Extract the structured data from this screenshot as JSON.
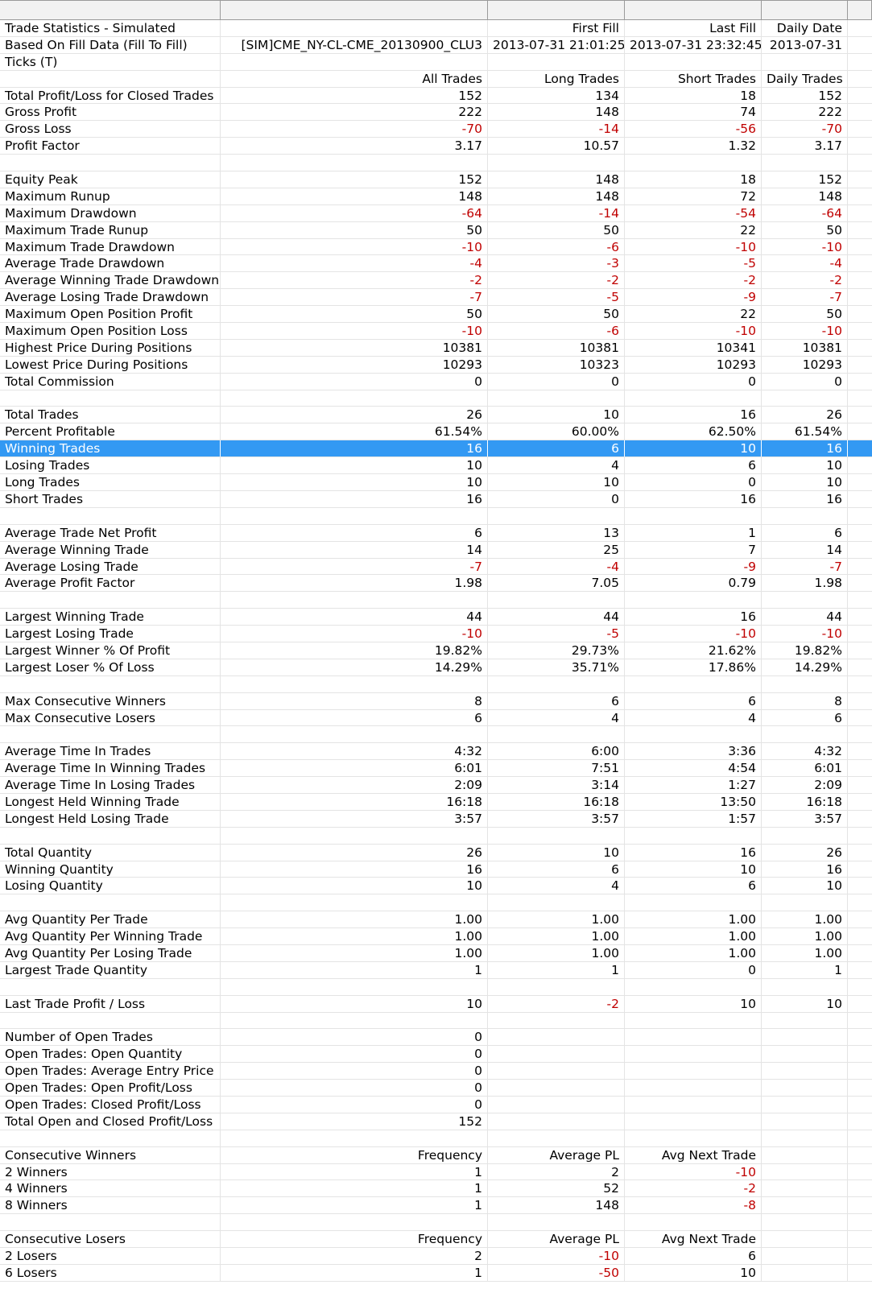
{
  "window": {
    "header_cells": [
      "",
      "",
      "",
      "",
      "",
      ""
    ]
  },
  "accent_color": "#3399f3",
  "negative_color": "#c00000",
  "selected_row": 25,
  "rows": [
    [
      "Trade Statistics - Simulated",
      "",
      "First Fill",
      "Last Fill",
      "Daily Date"
    ],
    [
      "Based On Fill Data (Fill To Fill)",
      "[SIM]CME_NY-CL-CME_20130900_CLU3",
      "2013-07-31  21:01:25",
      "2013-07-31  23:32:45",
      "2013-07-31"
    ],
    [
      "Ticks (T)",
      "",
      "",
      "",
      ""
    ],
    [
      "",
      "All Trades",
      "Long Trades",
      "Short Trades",
      "Daily Trades"
    ],
    [
      "Total Profit/Loss for Closed Trades",
      "152",
      "134",
      "18",
      "152"
    ],
    [
      "Gross Profit",
      "222",
      "148",
      "74",
      "222"
    ],
    [
      "Gross Loss",
      "-70",
      "-14",
      "-56",
      "-70"
    ],
    [
      "Profit Factor",
      "3.17",
      "10.57",
      "1.32",
      "3.17"
    ],
    [
      "",
      "",
      "",
      "",
      ""
    ],
    [
      "Equity Peak",
      "152",
      "148",
      "18",
      "152"
    ],
    [
      "Maximum Runup",
      "148",
      "148",
      "72",
      "148"
    ],
    [
      "Maximum Drawdown",
      "-64",
      "-14",
      "-54",
      "-64"
    ],
    [
      "Maximum Trade Runup",
      "50",
      "50",
      "22",
      "50"
    ],
    [
      "Maximum Trade Drawdown",
      "-10",
      "-6",
      "-10",
      "-10"
    ],
    [
      "Average Trade Drawdown",
      "-4",
      "-3",
      "-5",
      "-4"
    ],
    [
      "Average Winning Trade Drawdown",
      "-2",
      "-2",
      "-2",
      "-2"
    ],
    [
      "Average Losing Trade Drawdown",
      "-7",
      "-5",
      "-9",
      "-7"
    ],
    [
      "Maximum Open Position Profit",
      "50",
      "50",
      "22",
      "50"
    ],
    [
      "Maximum Open Position Loss",
      "-10",
      "-6",
      "-10",
      "-10"
    ],
    [
      "Highest Price During Positions",
      "10381",
      "10381",
      "10341",
      "10381"
    ],
    [
      "Lowest Price During Positions",
      "10293",
      "10323",
      "10293",
      "10293"
    ],
    [
      "Total Commission",
      "0",
      "0",
      "0",
      "0"
    ],
    [
      "",
      "",
      "",
      "",
      ""
    ],
    [
      "Total Trades",
      "26",
      "10",
      "16",
      "26"
    ],
    [
      "Percent Profitable",
      "61.54%",
      "60.00%",
      "62.50%",
      "61.54%"
    ],
    [
      "Winning Trades",
      "16",
      "6",
      "10",
      "16"
    ],
    [
      "Losing Trades",
      "10",
      "4",
      "6",
      "10"
    ],
    [
      "Long Trades",
      "10",
      "10",
      "0",
      "10"
    ],
    [
      "Short Trades",
      "16",
      "0",
      "16",
      "16"
    ],
    [
      "",
      "",
      "",
      "",
      ""
    ],
    [
      "Average Trade Net Profit",
      "6",
      "13",
      "1",
      "6"
    ],
    [
      "Average Winning Trade",
      "14",
      "25",
      "7",
      "14"
    ],
    [
      "Average Losing Trade",
      "-7",
      "-4",
      "-9",
      "-7"
    ],
    [
      "Average Profit Factor",
      "1.98",
      "7.05",
      "0.79",
      "1.98"
    ],
    [
      "",
      "",
      "",
      "",
      ""
    ],
    [
      "Largest Winning Trade",
      "44",
      "44",
      "16",
      "44"
    ],
    [
      "Largest Losing Trade",
      "-10",
      "-5",
      "-10",
      "-10"
    ],
    [
      "Largest Winner % Of Profit",
      "19.82%",
      "29.73%",
      "21.62%",
      "19.82%"
    ],
    [
      "Largest Loser % Of Loss",
      "14.29%",
      "35.71%",
      "17.86%",
      "14.29%"
    ],
    [
      "",
      "",
      "",
      "",
      ""
    ],
    [
      "Max Consecutive Winners",
      "8",
      "6",
      "6",
      "8"
    ],
    [
      "Max Consecutive Losers",
      "6",
      "4",
      "4",
      "6"
    ],
    [
      "",
      "",
      "",
      "",
      ""
    ],
    [
      "Average Time In Trades",
      "4:32",
      "6:00",
      "3:36",
      "4:32"
    ],
    [
      "Average Time In Winning Trades",
      "6:01",
      "7:51",
      "4:54",
      "6:01"
    ],
    [
      "Average Time In Losing Trades",
      "2:09",
      "3:14",
      "1:27",
      "2:09"
    ],
    [
      "Longest Held Winning Trade",
      "16:18",
      "16:18",
      "13:50",
      "16:18"
    ],
    [
      "Longest Held Losing Trade",
      "3:57",
      "3:57",
      "1:57",
      "3:57"
    ],
    [
      "",
      "",
      "",
      "",
      ""
    ],
    [
      "Total Quantity",
      "26",
      "10",
      "16",
      "26"
    ],
    [
      "Winning Quantity",
      "16",
      "6",
      "10",
      "16"
    ],
    [
      "Losing Quantity",
      "10",
      "4",
      "6",
      "10"
    ],
    [
      "",
      "",
      "",
      "",
      ""
    ],
    [
      "Avg Quantity Per Trade",
      "1.00",
      "1.00",
      "1.00",
      "1.00"
    ],
    [
      "Avg Quantity Per Winning Trade",
      "1.00",
      "1.00",
      "1.00",
      "1.00"
    ],
    [
      "Avg Quantity Per Losing Trade",
      "1.00",
      "1.00",
      "1.00",
      "1.00"
    ],
    [
      "Largest Trade Quantity",
      "1",
      "1",
      "0",
      "1"
    ],
    [
      "",
      "",
      "",
      "",
      ""
    ],
    [
      "Last Trade Profit / Loss",
      "10",
      "-2",
      "10",
      "10"
    ],
    [
      "",
      "",
      "",
      "",
      ""
    ],
    [
      "Number of Open Trades",
      "0",
      "",
      "",
      ""
    ],
    [
      "Open Trades: Open Quantity",
      "0",
      "",
      "",
      ""
    ],
    [
      "Open Trades: Average Entry Price",
      "0",
      "",
      "",
      ""
    ],
    [
      "Open Trades: Open Profit/Loss",
      "0",
      "",
      "",
      ""
    ],
    [
      "Open Trades: Closed Profit/Loss",
      "0",
      "",
      "",
      ""
    ],
    [
      "Total Open and Closed Profit/Loss",
      "152",
      "",
      "",
      ""
    ],
    [
      "",
      "",
      "",
      "",
      ""
    ],
    [
      "Consecutive Winners",
      "Frequency",
      "Average PL",
      "Avg Next Trade",
      ""
    ],
    [
      "2 Winners",
      "1",
      "2",
      "-10",
      ""
    ],
    [
      "4 Winners",
      "1",
      "52",
      "-2",
      ""
    ],
    [
      "8 Winners",
      "1",
      "148",
      "-8",
      ""
    ],
    [
      "",
      "",
      "",
      "",
      ""
    ],
    [
      "Consecutive Losers",
      "Frequency",
      "Average PL",
      "Avg Next Trade",
      ""
    ],
    [
      "2 Losers",
      "2",
      "-10",
      "6",
      ""
    ],
    [
      "6 Losers",
      "1",
      "-50",
      "10",
      ""
    ]
  ]
}
